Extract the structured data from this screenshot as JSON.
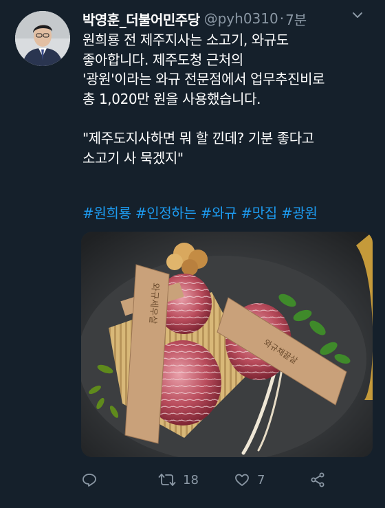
{
  "tweet": {
    "author_name": "박영훈_더불어민주당",
    "handle": "@pyh0310",
    "separator": "·",
    "time": "7분",
    "lines": [
      "원희룡 전 제주지사는 소고기, 와규도",
      "좋아합니다. 제주도청 근처의",
      "'광원'이라는 와규 전문점에서 업무추진비로",
      "총 1,020만 원을 사용했습니다."
    ],
    "quote_lines": [
      "\"제주도지사하면 뭐 할 낀데? 기분 좋다고",
      "소고기 사 묵겠지\""
    ],
    "hashtags": [
      "#원희룡",
      "#인정하는",
      "#와규",
      "#맛집",
      "#광원"
    ],
    "photo_plaque_left": "와규세우살",
    "photo_plaque_right": "와규채끝살"
  },
  "actions": {
    "reply_count": "",
    "retweet_count": "18",
    "like_count": "7"
  },
  "colors": {
    "background": "#15202b",
    "text": "#ffffff",
    "secondary": "#8b98a5",
    "link": "#1d9bf0"
  },
  "icons": [
    "reply-icon",
    "retweet-icon",
    "heart-icon",
    "share-icon",
    "more-icon"
  ]
}
